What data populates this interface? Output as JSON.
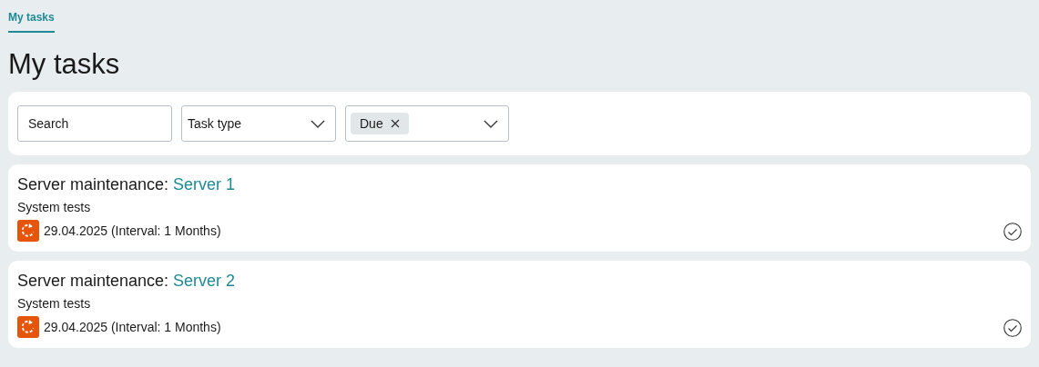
{
  "breadcrumb": {
    "label": "My tasks",
    "selected": true
  },
  "title": "My tasks",
  "filters": {
    "search": {
      "placeholder": "Search"
    },
    "task_type": {
      "placeholder": "Task type"
    },
    "status": {
      "chips": [
        "Due"
      ]
    }
  },
  "tasks": [
    {
      "title": "Server maintenance:",
      "link": "Server 1",
      "subtitle": "System tests",
      "due": "29.04.2025 (Interval: 1 Months)"
    },
    {
      "title": "Server maintenance:",
      "link": "Server 2",
      "subtitle": "System tests",
      "due": "29.04.2025 (Interval: 1 Months)"
    }
  ]
}
